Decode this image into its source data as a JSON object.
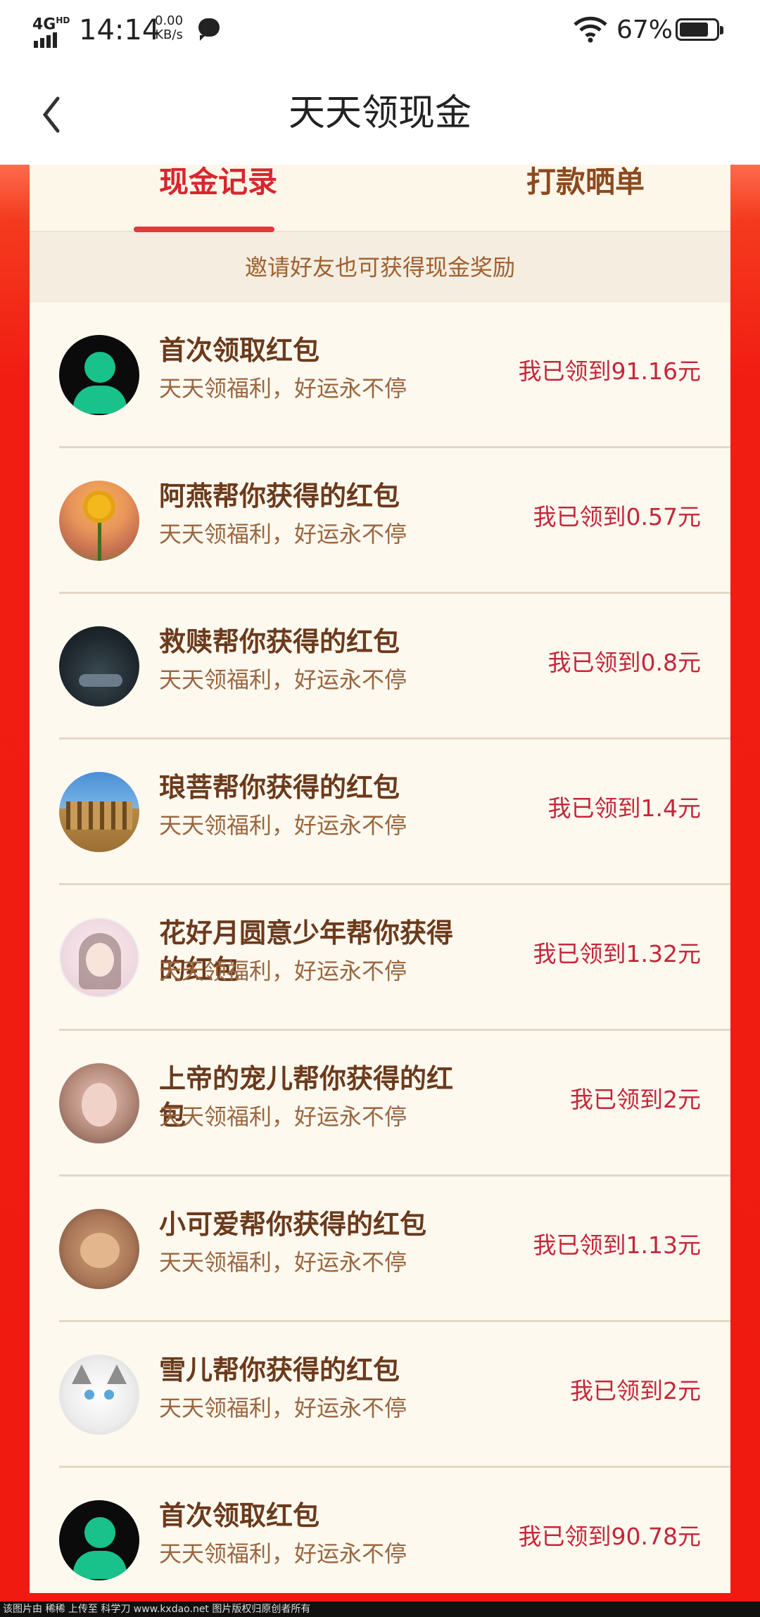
{
  "status_bar": {
    "network": "4G",
    "network_sup": "HD",
    "time": "14:14",
    "speed_value": "0.00",
    "speed_unit": "KB/s",
    "battery_percent": "67%",
    "icons": [
      "signal-icon",
      "message-icon",
      "wifi-icon",
      "battery-icon"
    ]
  },
  "header": {
    "title": "天天领现金",
    "back_icon": "chevron-left-icon"
  },
  "tabs": [
    {
      "label": "现金记录",
      "active": true
    },
    {
      "label": "打款晒单",
      "active": false
    }
  ],
  "invite_banner": "邀请好友也可获得现金奖励",
  "records": [
    {
      "title": "首次领取红包",
      "subtitle": "天天领福利，好运永不停",
      "amount": "我已领到91.16元",
      "avatar": "default-avatar"
    },
    {
      "title": "阿燕帮你获得的红包",
      "subtitle": "天天领福利，好运永不停",
      "amount": "我已领到0.57元",
      "avatar": "sunflower-avatar"
    },
    {
      "title": "救赎帮你获得的红包",
      "subtitle": "天天领福利，好运永不停",
      "amount": "我已领到0.8元",
      "avatar": "dark-avatar"
    },
    {
      "title": "琅菩帮你获得的红包",
      "subtitle": "天天领福利，好运永不停",
      "amount": "我已领到1.4元",
      "avatar": "arch-avatar"
    },
    {
      "title": "花好月圆意少年帮你获得的红包",
      "subtitle": "天天领福利，好运永不停",
      "amount": "我已领到1.32元",
      "avatar": "girl-avatar"
    },
    {
      "title": "上帝的宠儿帮你获得的红包",
      "subtitle": "天天领福利，好运永不停",
      "amount": "我已领到2元",
      "avatar": "woman-avatar"
    },
    {
      "title": "小可爱帮你获得的红包",
      "subtitle": "天天领福利，好运永不停",
      "amount": "我已领到1.13元",
      "avatar": "cat-avatar"
    },
    {
      "title": "雪儿帮你获得的红包",
      "subtitle": "天天领福利，好运永不停",
      "amount": "我已领到2元",
      "avatar": "white-cat-avatar"
    },
    {
      "title": "首次领取红包",
      "subtitle": "天天领福利，好运永不停",
      "amount": "我已领到90.78元",
      "avatar": "default-avatar"
    }
  ],
  "watermark": "该图片由 稀稀 上传至 科学刀 www.kxdao.net 图片版权归原创者所有",
  "colors": {
    "accent_red": "#f01a10",
    "tab_active": "#d8262e",
    "amount_red": "#c5263a",
    "title_brown": "#6b3a1c",
    "panel_bg": "#fdf9ef"
  }
}
